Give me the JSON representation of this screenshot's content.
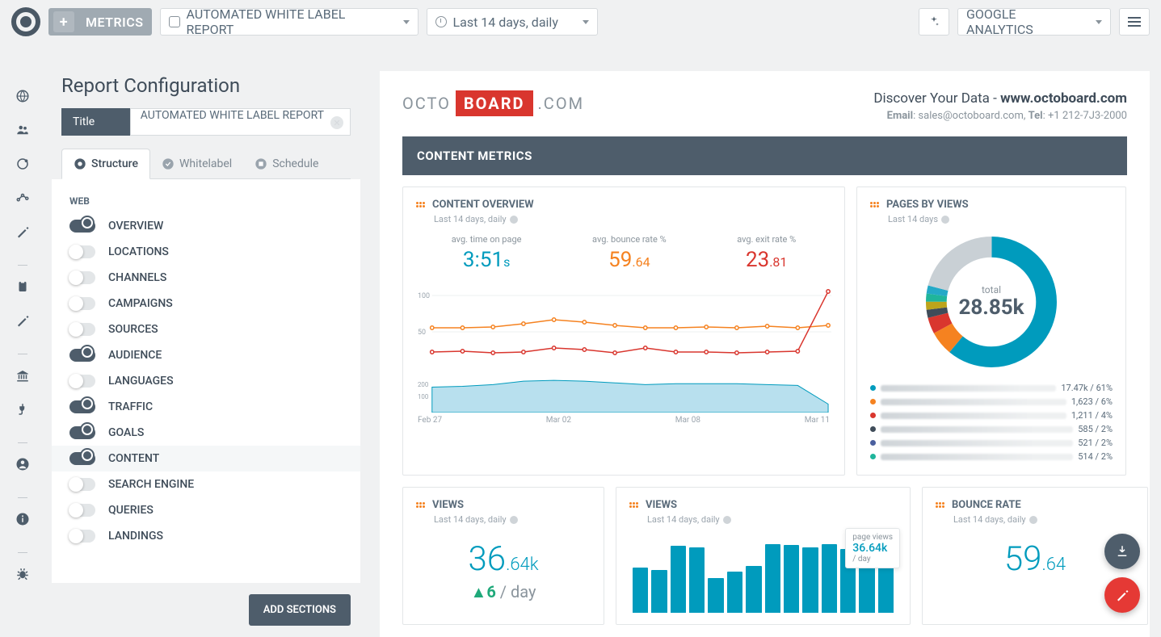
{
  "topbar": {
    "metrics_btn": "METRICS",
    "report_dd": "AUTOMATED WHITE LABEL REPORT",
    "range_dd": "Last 14 days, daily",
    "ga_dd": "GOOGLE ANALYTICS"
  },
  "config": {
    "title": "Report Configuration",
    "title_field_label": "Title",
    "title_field_value": "AUTOMATED WHITE LABEL REPORT",
    "tabs": {
      "structure": "Structure",
      "whitelabel": "Whitelabel",
      "schedule": "Schedule"
    },
    "section_heading": "WEB",
    "items": [
      {
        "label": "OVERVIEW",
        "on": true
      },
      {
        "label": "LOCATIONS",
        "on": false
      },
      {
        "label": "CHANNELS",
        "on": false
      },
      {
        "label": "CAMPAIGNS",
        "on": false
      },
      {
        "label": "SOURCES",
        "on": false
      },
      {
        "label": "AUDIENCE",
        "on": true
      },
      {
        "label": "LANGUAGES",
        "on": false
      },
      {
        "label": "TRAFFIC",
        "on": true
      },
      {
        "label": "GOALS",
        "on": true
      },
      {
        "label": "CONTENT",
        "on": true,
        "highlight": true
      },
      {
        "label": "SEARCH ENGINE",
        "on": false
      },
      {
        "label": "QUERIES",
        "on": false
      },
      {
        "label": "LANDINGS",
        "on": false
      }
    ],
    "add_btn": "ADD SECTIONS"
  },
  "report": {
    "logo": {
      "a": "OCTO",
      "b": "BOARD",
      "c": ".COM"
    },
    "tagline": {
      "pre": "Discover Your Data - ",
      "bold": "www.octoboard.com"
    },
    "contact": {
      "email_l": "Email",
      "email": ": sales@octoboard.com, ",
      "tel_l": "Tel",
      "tel": ": +1 212-7J3-2000"
    },
    "banner": "CONTENT METRICS",
    "sub14d": "Last 14 days, daily",
    "sub14": "Last 14 days",
    "overview": {
      "title": "CONTENT OVERVIEW",
      "m1_l": "avg. time on page",
      "m1_v": "3:51",
      "m1_s": "s",
      "m2_l": "avg. bounce rate %",
      "m2_v": "59",
      "m2_s": ".64",
      "m3_l": "avg. exit rate %",
      "m3_v": "23",
      "m3_s": ".81",
      "xlabels": [
        "Feb 27",
        "Mar 02",
        "Mar 08",
        "Mar 11"
      ]
    },
    "pages": {
      "title": "PAGES BY VIEWS",
      "total_l": "total",
      "total_v": "28.85k",
      "legend": [
        {
          "color": "#009bbd",
          "val": "17.47k / 61%"
        },
        {
          "color": "#f58220",
          "val": "1,623 / 6%"
        },
        {
          "color": "#d9362e",
          "val": "1,211 / 4%"
        },
        {
          "color": "#3f4c59",
          "val": "585 / 2%"
        },
        {
          "color": "#4a5f9e",
          "val": "521 / 2%"
        },
        {
          "color": "#1fb59b",
          "val": "514 / 2%"
        }
      ]
    },
    "views1": {
      "title": "VIEWS",
      "val": "36",
      "val_s": ".64k",
      "delta": "6",
      "delta_suffix": " / day"
    },
    "views2": {
      "title": "VIEWS",
      "tooltip_l": "page views",
      "tooltip_v": "36.64k",
      "tooltip_s": "/ day"
    },
    "bounce": {
      "title": "BOUNCE RATE",
      "val": "59",
      "val_s": ".64"
    }
  },
  "chart_data": {
    "overview_lines": {
      "type": "line",
      "y_ticks": [
        50,
        100
      ],
      "x_categories": [
        "Feb 27",
        "Mar 02",
        "Mar 08",
        "Mar 11"
      ],
      "series": [
        {
          "name": "bounce_rate",
          "color": "#f58220",
          "values": [
            55,
            55,
            56,
            60,
            65,
            62,
            58,
            55,
            55,
            56,
            55,
            57,
            55,
            58
          ]
        },
        {
          "name": "exit_rate",
          "color": "#d9362e",
          "values": [
            25,
            26,
            24,
            25,
            30,
            28,
            24,
            30,
            25,
            25,
            24,
            25,
            26,
            100
          ]
        }
      ]
    },
    "overview_area": {
      "type": "area",
      "y_ticks": [
        100,
        200
      ],
      "x_categories": [
        "Feb 27",
        "Mar 02",
        "Mar 08",
        "Mar 11"
      ],
      "values": [
        150,
        155,
        165,
        185,
        190,
        185,
        175,
        165,
        170,
        170,
        170,
        165,
        160,
        50
      ]
    },
    "pages_donut": {
      "type": "pie",
      "total_label": "total",
      "total": "28.85k",
      "slices": [
        {
          "color": "#009bbd",
          "pct": 61
        },
        {
          "color": "#f58220",
          "pct": 6
        },
        {
          "color": "#d9362e",
          "pct": 4
        },
        {
          "color": "#3f4c59",
          "pct": 2
        },
        {
          "color": "#bda41b",
          "pct": 2
        },
        {
          "color": "#1fb59b",
          "pct": 2
        },
        {
          "color": "#24a9c7",
          "pct": 2
        },
        {
          "color": "#c9d0d5",
          "pct": 21
        }
      ]
    },
    "views_bars": {
      "type": "bar",
      "values": [
        65,
        62,
        97,
        95,
        50,
        60,
        68,
        100,
        98,
        95,
        100,
        92,
        98,
        100
      ]
    }
  }
}
